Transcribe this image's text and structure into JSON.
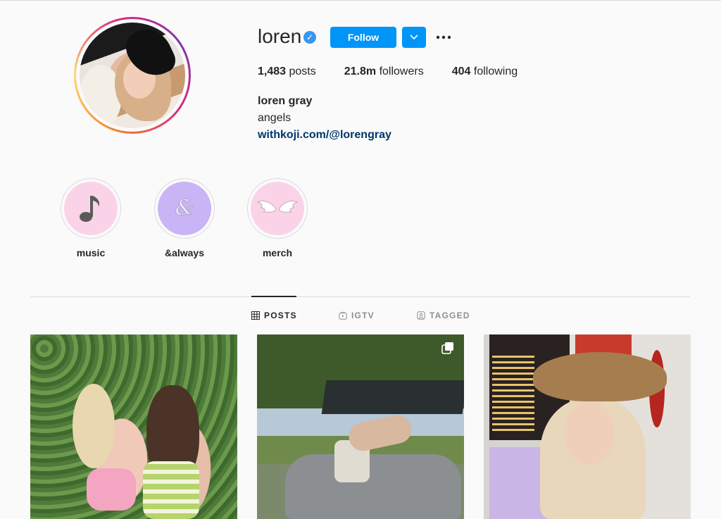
{
  "profile": {
    "username": "loren",
    "verified_icon": "verified-badge-icon",
    "follow_label": "Follow",
    "stats": {
      "posts_count": "1,483",
      "posts_label": "posts",
      "followers_count": "21.8m",
      "followers_label": "followers",
      "following_count": "404",
      "following_label": "following"
    },
    "full_name": "loren gray",
    "bio": "angels",
    "link": "withkoji.com/@lorengray"
  },
  "highlights": [
    {
      "label": "music",
      "icon": "music-note-icon",
      "color": "#fbd3e9"
    },
    {
      "label": "&always",
      "icon": "ampersand-icon",
      "color": "#c9b5f5"
    },
    {
      "label": "merch",
      "icon": "angel-wings-icon",
      "color": "#fbd3e9"
    }
  ],
  "tabs": [
    {
      "label": "POSTS",
      "icon": "grid-icon",
      "active": true
    },
    {
      "label": "IGTV",
      "icon": "igtv-icon",
      "active": false
    },
    {
      "label": "TAGGED",
      "icon": "tagged-icon",
      "active": false
    }
  ],
  "colors": {
    "accent": "#0095f6",
    "link": "#00376b",
    "background": "#fafafa"
  }
}
